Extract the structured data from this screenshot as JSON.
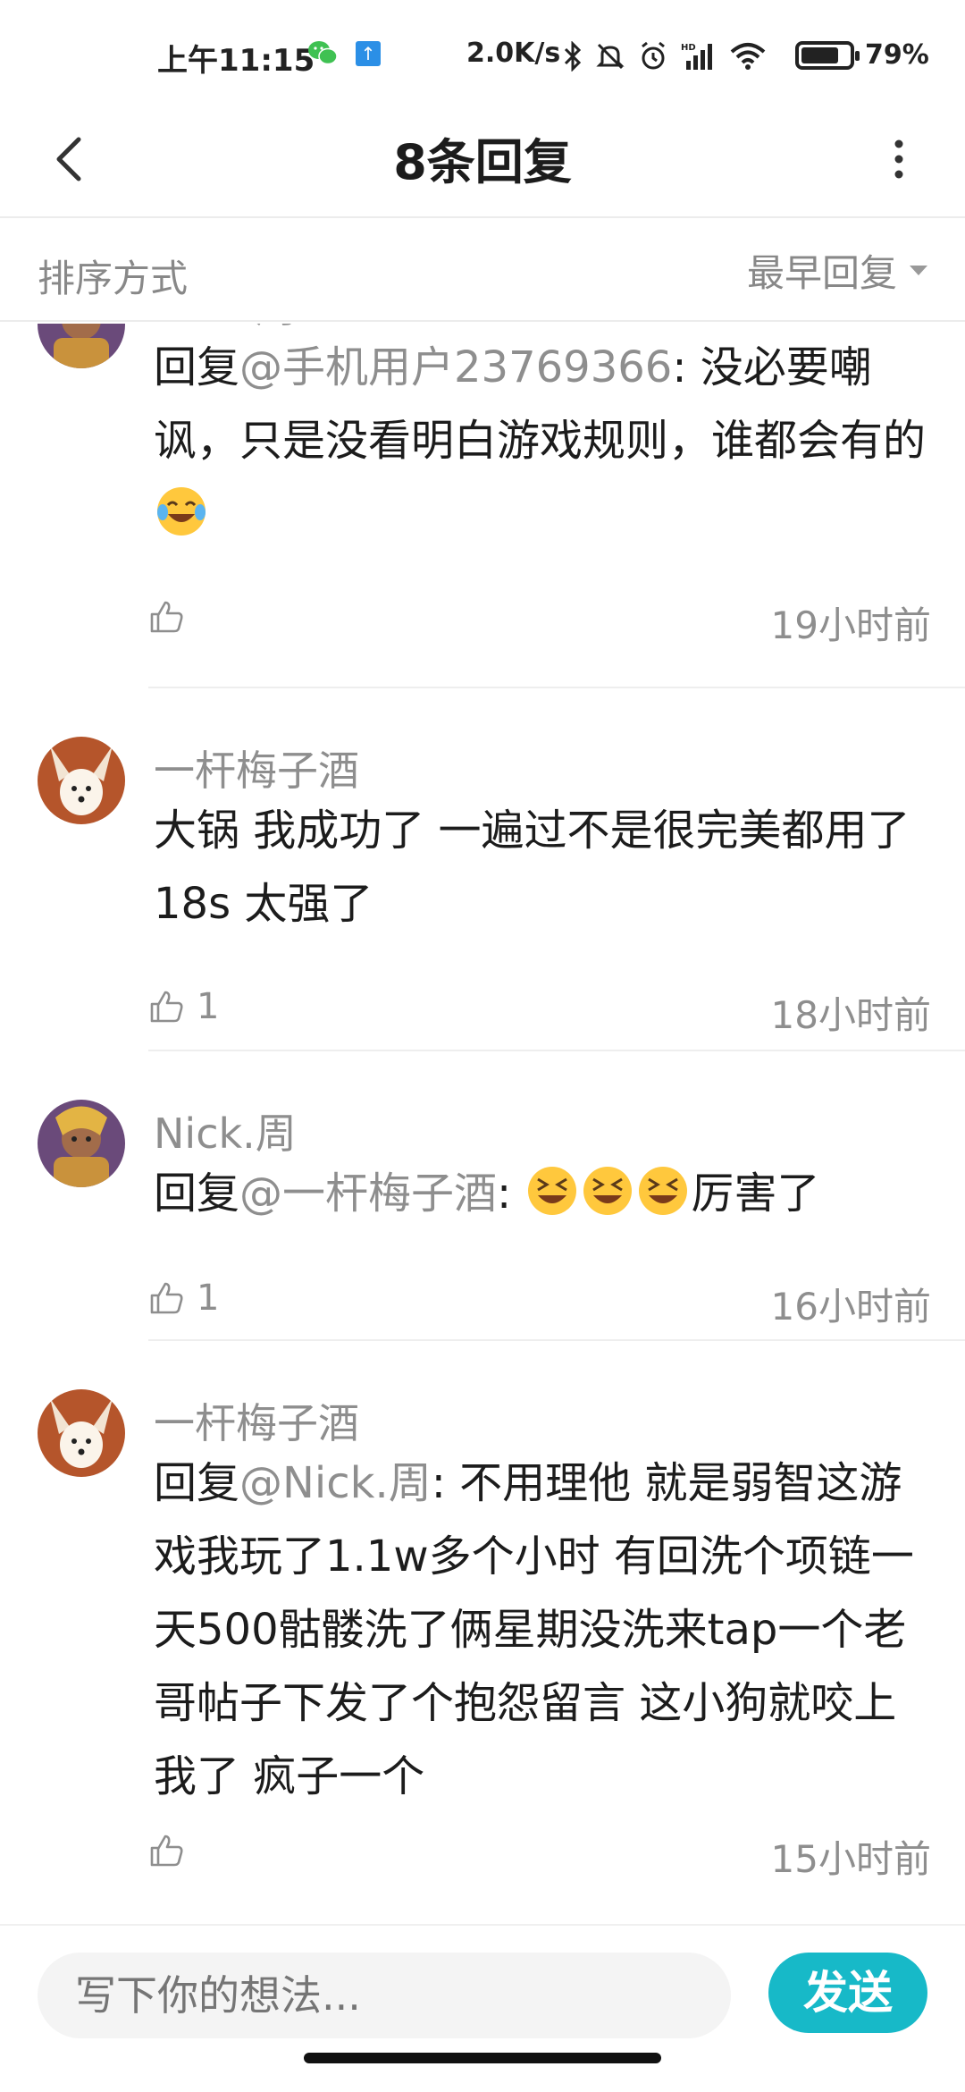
{
  "status_bar": {
    "time": "上午11:15",
    "network_speed": "2.0K/s",
    "battery_level": 79,
    "battery_text": "79%",
    "icons": [
      "wechat-icon",
      "upload-icon",
      "bluetooth-icon",
      "mute-icon",
      "alarm-icon",
      "signal-icon",
      "wifi-icon",
      "battery-icon"
    ]
  },
  "header": {
    "title": "8条回复",
    "back_icon": "chevron-left-icon",
    "more_icon": "more-vertical-icon"
  },
  "sort": {
    "label": "排序方式",
    "selected": "最早回复"
  },
  "comments": [
    {
      "user": "Nick.周",
      "reply_prefix": "回复",
      "mention": "@手机用户23769366",
      "text": ": 没必要嘲讽，只是没看明白游戏规则，谁都会有的",
      "emoji": [
        "tears-of-joy-emoji"
      ],
      "likes": "",
      "time": "19小时前"
    },
    {
      "user": "一杆梅子酒",
      "text": "大锅 我成功了 一遍过不是很完美都用了18s 太强了",
      "likes": "1",
      "time": "18小时前"
    },
    {
      "user": "Nick.周",
      "reply_prefix": "回复",
      "mention": "@一杆梅子酒",
      "text": ": ",
      "text_after": "厉害了",
      "emoji": [
        "grinning-squint-emoji",
        "grinning-squint-emoji",
        "grinning-squint-emoji"
      ],
      "likes": "1",
      "time": "16小时前"
    },
    {
      "user": "一杆梅子酒",
      "reply_prefix": "回复",
      "mention": "@Nick.周",
      "text": ": 不用理他 就是弱智这游戏我玩了1.1w多个小时 有回洗个项链一天500骷髅洗了俩星期没洗来tap一个老哥帖子下发了个抱怨留言 这小狗就咬上我了 疯子一个",
      "likes": "",
      "time": "15小时前"
    }
  ],
  "composer": {
    "placeholder": "写下你的想法...",
    "send_label": "发送"
  },
  "colors": {
    "accent": "#17b9c8",
    "secondary_text": "#8e8e8e",
    "primary_text": "#1c1c1c"
  }
}
